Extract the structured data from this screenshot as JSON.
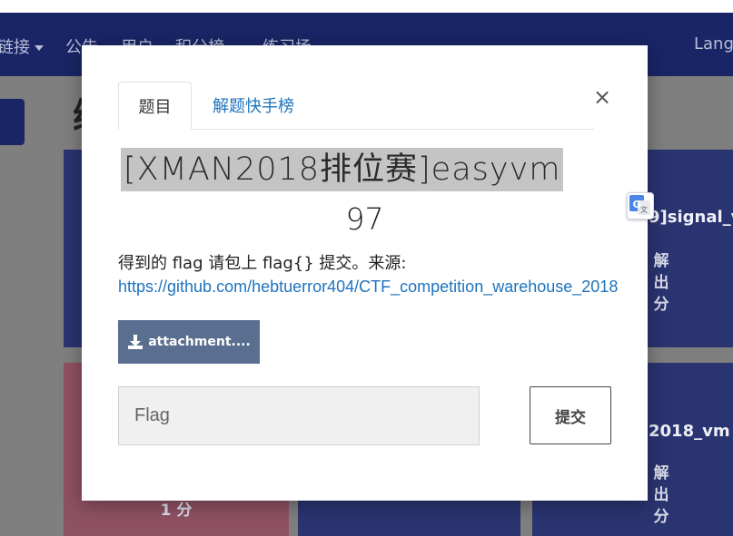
{
  "nav": {
    "items": [
      {
        "label": "链接",
        "has_caret": true
      },
      {
        "label": "公告",
        "has_caret": false
      },
      {
        "label": "用户",
        "has_caret": false
      },
      {
        "label": "积分榜",
        "has_caret": true
      },
      {
        "label": "练习场",
        "has_caret": true
      }
    ],
    "lang_label": "Lang"
  },
  "page": {
    "heading_fragment": "练"
  },
  "cards": {
    "right_top_name": "9]signal_v",
    "right_top_score": "解出\n分",
    "right_bottom_name": "2018_vm",
    "right_bottom_score": "解出\n分",
    "pink_score": "1 分"
  },
  "modal": {
    "tab_challenge": "题目",
    "tab_solves": "解题快手榜",
    "close_symbol": "×",
    "title": "[XMAN2018排位赛]easyvm",
    "value": "97",
    "description": "得到的 flag 请包上 flag{} 提交。来源:",
    "source_link": "https://github.com/hebtuerror404/CTF_competition_warehouse_2018",
    "attachment_label": "attachment....",
    "flag_placeholder": "Flag",
    "submit_label": "提交"
  },
  "colors": {
    "navbar": "#1a2566",
    "card_blue": "#2a3470",
    "card_pink": "#8e5162",
    "link": "#1e73be",
    "attachment_btn": "#5a6f8f"
  },
  "icons": {
    "download": "download-icon",
    "translate": "google-translate-icon",
    "caret": "caret-down-icon"
  }
}
